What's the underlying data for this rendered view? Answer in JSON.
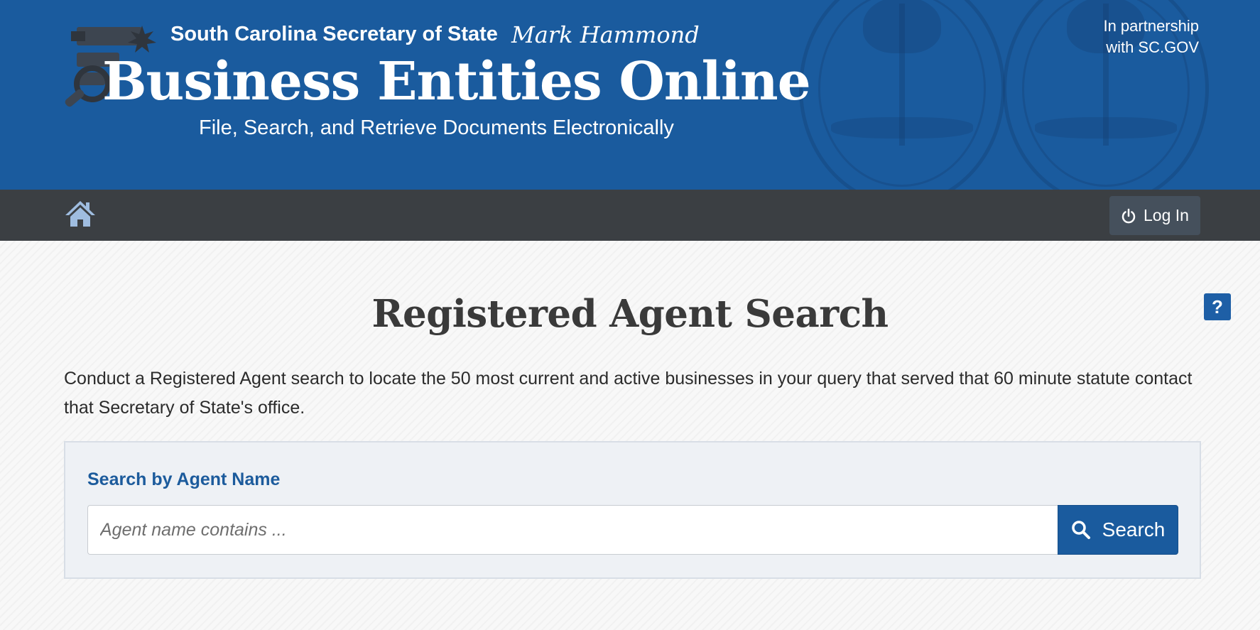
{
  "header": {
    "sos_title": "South Carolina Secretary of State",
    "signature": "Mark Hammond",
    "app_title": "Business Entities Online",
    "app_subtitle": "File, Search, and Retrieve Documents Electronically",
    "partnership_line1": "In partnership",
    "partnership_line2": "with SC.GOV"
  },
  "nav": {
    "home_icon": "home-icon",
    "login_label": "Log In",
    "login_icon": "power-icon"
  },
  "main": {
    "help_label": "?",
    "page_title": "Registered Agent Search",
    "intro": "Conduct a Registered Agent search to locate the 50 most current and active businesses in your query that served that 60 minute statute contact that Secretary of State's office.",
    "search_panel": {
      "label": "Search by Agent Name",
      "input_value": "",
      "input_placeholder": "Agent name contains ...",
      "button_label": "Search",
      "button_icon": "search-icon"
    }
  },
  "colors": {
    "banner": "#1a5b9e",
    "navbar": "#3b3f43",
    "accent": "#1c5b9c",
    "panel": "#eef1f5"
  }
}
